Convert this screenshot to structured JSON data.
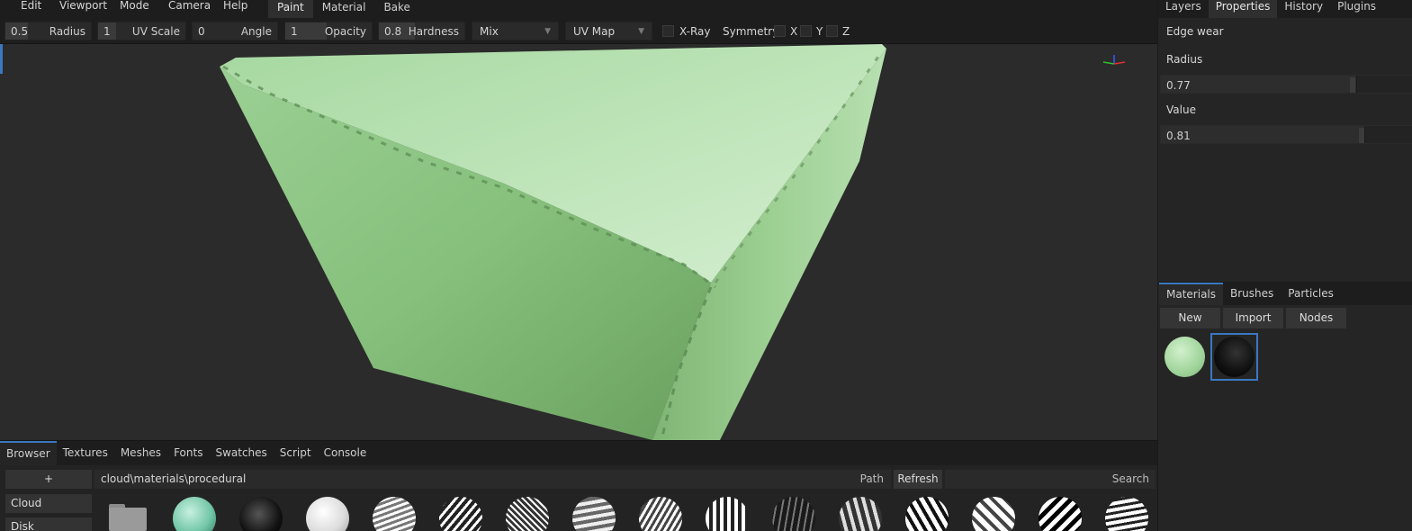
{
  "menu": [
    "Edit",
    "Viewport",
    "Mode",
    "Camera",
    "Help"
  ],
  "mode_tabs": [
    {
      "label": "Paint",
      "active": true
    },
    {
      "label": "Material",
      "active": false
    },
    {
      "label": "Bake",
      "active": false
    }
  ],
  "toolbar": {
    "radius": {
      "value": "0.5",
      "label": "Radius",
      "fill": 0.5
    },
    "uv_scale": {
      "value": "1",
      "label": "UV Scale",
      "fill": 0.15
    },
    "angle": {
      "value": "0",
      "label": "Angle",
      "fill": 0
    },
    "opacity": {
      "value": "1",
      "label": "Opacity",
      "fill": 1
    },
    "hardness": {
      "value": "0.8",
      "label": "Hardness",
      "fill": 0.8
    },
    "blend": "Mix",
    "mapping": "UV Map",
    "xray": "X-Ray",
    "symmetry": "Symmetry",
    "x": "X",
    "y": "Y",
    "z": "Z"
  },
  "right_tabs": [
    {
      "label": "Layers",
      "active": false
    },
    {
      "label": "Properties",
      "active": true
    },
    {
      "label": "History",
      "active": false
    },
    {
      "label": "Plugins",
      "active": false
    }
  ],
  "properties": {
    "title": "Edge wear",
    "radius_label": "Radius",
    "radius_value": "0.77",
    "radius_fill": 0.77,
    "value_label": "Value",
    "value_value": "0.81",
    "value_fill": 0.81
  },
  "material_tabs": [
    {
      "label": "Materials",
      "active": true
    },
    {
      "label": "Brushes",
      "active": false
    },
    {
      "label": "Particles",
      "active": false
    }
  ],
  "material_buttons": [
    "New",
    "Import",
    "Nodes"
  ],
  "browser_tabs": [
    {
      "label": "Browser",
      "active": true
    },
    {
      "label": "Textures",
      "active": false
    },
    {
      "label": "Meshes",
      "active": false
    },
    {
      "label": "Fonts",
      "active": false
    },
    {
      "label": "Swatches",
      "active": false
    },
    {
      "label": "Script",
      "active": false
    },
    {
      "label": "Console",
      "active": false
    }
  ],
  "browser": {
    "add": "+",
    "path": "cloud\\materials\\procedural",
    "path_label": "Path",
    "refresh": "Refresh",
    "search": "Search",
    "side_items": [
      "Cloud",
      "Disk"
    ]
  },
  "colors": {
    "accent": "#3a78c0",
    "cube": "#9fd49a"
  }
}
